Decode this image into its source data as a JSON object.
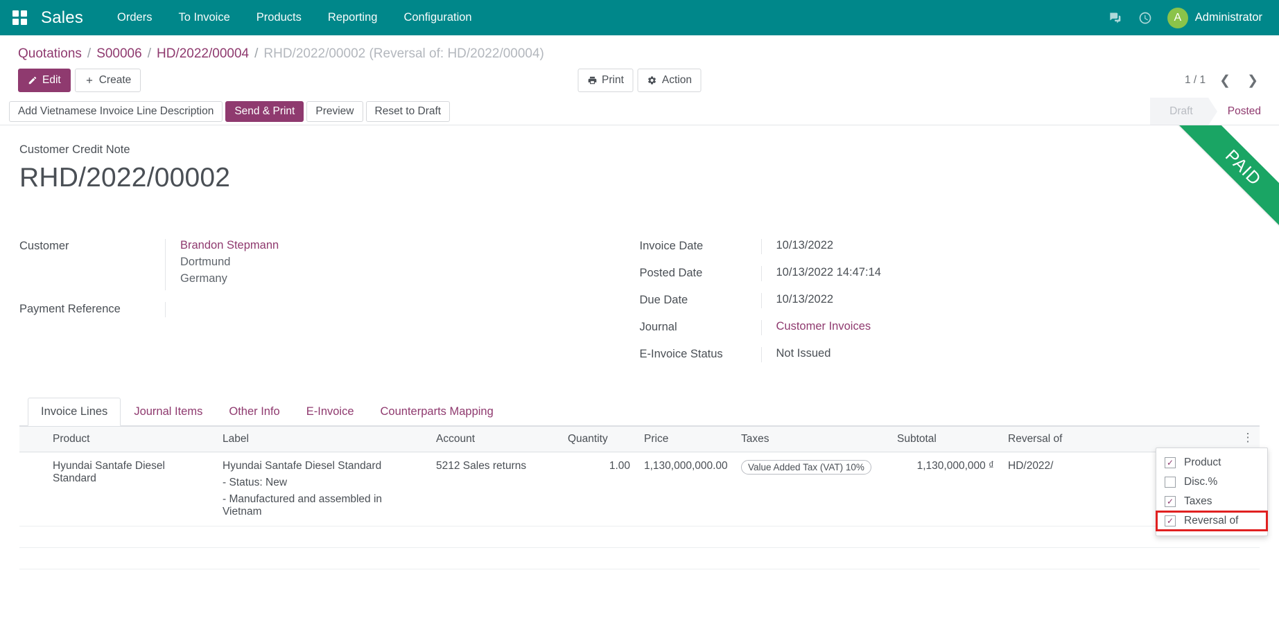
{
  "navbar": {
    "apps_icon": "apps-grid-icon",
    "brand": "Sales",
    "menu": [
      {
        "label": "Orders"
      },
      {
        "label": "To Invoice"
      },
      {
        "label": "Products"
      },
      {
        "label": "Reporting"
      },
      {
        "label": "Configuration"
      }
    ],
    "messages_icon": "chat-bubble-icon",
    "activities_icon": "clock-icon",
    "avatar_initial": "A",
    "user_name": "Administrator",
    "brand_color": "#00878a"
  },
  "breadcrumb": {
    "items": [
      {
        "label": "Quotations",
        "active": false
      },
      {
        "label": "S00006",
        "active": false
      },
      {
        "label": "HD/2022/00004",
        "active": false
      },
      {
        "label": "RHD/2022/00002 (Reversal of: HD/2022/00004)",
        "active": true
      }
    ],
    "separator": "/"
  },
  "control_bar": {
    "edit_label": "Edit",
    "create_label": "Create",
    "print_label": "Print",
    "action_label": "Action",
    "pager_text": "1 / 1",
    "prev_icon": "chevron-left-icon",
    "next_icon": "chevron-right-icon"
  },
  "statusbar": {
    "buttons": [
      {
        "label": "Add Vietnamese Invoice Line Description",
        "primary": false
      },
      {
        "label": "Send & Print",
        "primary": true
      },
      {
        "label": "Preview",
        "primary": false
      },
      {
        "label": "Reset to Draft",
        "primary": false
      }
    ],
    "stages": [
      {
        "label": "Draft",
        "current": false
      },
      {
        "label": "Posted",
        "current": true
      }
    ]
  },
  "sheet": {
    "ribbon": "PAID",
    "ribbon_color": "#1aa564",
    "doc_type": "Customer Credit Note",
    "doc_title": "RHD/2022/00002",
    "left_fields": [
      {
        "label": "Customer",
        "value": "Brandon Stepmann",
        "extra": [
          "Dortmund",
          "Germany"
        ]
      },
      {
        "label": "Payment Reference",
        "value": "",
        "extra": []
      }
    ],
    "right_fields": [
      {
        "label": "Invoice Date",
        "value": "10/13/2022",
        "link": false
      },
      {
        "label": "Posted Date",
        "value": "10/13/2022 14:47:14",
        "link": false
      },
      {
        "label": "Due Date",
        "value": "10/13/2022",
        "link": false
      },
      {
        "label": "Journal",
        "value": "Customer Invoices",
        "link": true
      },
      {
        "label": "E-Invoice Status",
        "value": "Not Issued",
        "link": false
      }
    ]
  },
  "notebook": {
    "tabs": [
      {
        "label": "Invoice Lines",
        "active": true
      },
      {
        "label": "Journal Items",
        "active": false
      },
      {
        "label": "Other Info",
        "active": false
      },
      {
        "label": "E-Invoice",
        "active": false
      },
      {
        "label": "Counterparts Mapping",
        "active": false
      }
    ]
  },
  "lines_table": {
    "columns": [
      "Product",
      "Label",
      "Account",
      "Quantity",
      "Price",
      "Taxes",
      "Subtotal",
      "Reversal of"
    ],
    "options_icon": "vertical-dots-icon",
    "rows": [
      {
        "product": "Hyundai Santafe Diesel Standard",
        "label_main": "Hyundai Santafe Diesel Standard",
        "label_lines": [
          "- Status: New",
          "- Manufactured and assembled in Vietnam"
        ],
        "account": "5212 Sales returns",
        "quantity": "1.00",
        "price": "1,130,000,000.00",
        "taxes": "Value Added Tax (VAT) 10%",
        "subtotal": "1,130,000,000 ₫",
        "reversal_of": "HD/2022/"
      }
    ]
  },
  "column_dropdown": {
    "items": [
      {
        "label": "Product",
        "checked": true,
        "highlight": false
      },
      {
        "label": "Disc.%",
        "checked": false,
        "highlight": false
      },
      {
        "label": "Taxes",
        "checked": true,
        "highlight": false
      },
      {
        "label": "Reversal of",
        "checked": true,
        "highlight": true
      }
    ],
    "highlight_color": "#e02020"
  }
}
